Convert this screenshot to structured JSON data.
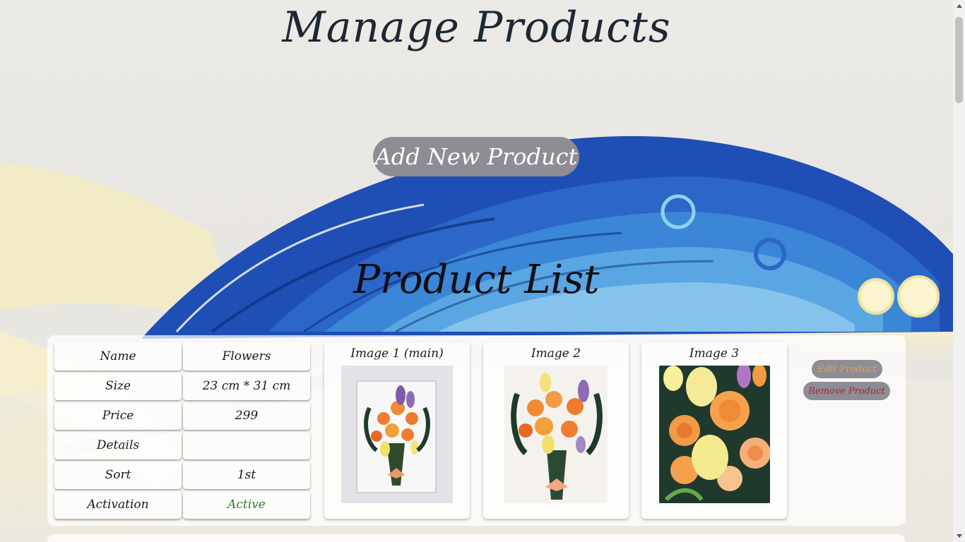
{
  "header": {
    "title": "Manage Products"
  },
  "actions": {
    "add_new_product": "Add New Product"
  },
  "list": {
    "title": "Product List"
  },
  "product": {
    "fields": [
      {
        "label": "Name",
        "value": "Flowers"
      },
      {
        "label": "Size",
        "value": "23 cm * 31 cm"
      },
      {
        "label": "Price",
        "value": "299"
      },
      {
        "label": "Details",
        "value": ""
      },
      {
        "label": "Sort",
        "value": "1st"
      },
      {
        "label": "Activation",
        "value": "Active"
      }
    ],
    "images": [
      {
        "label": "Image 1 (main)"
      },
      {
        "label": "Image 2"
      },
      {
        "label": "Image 3"
      }
    ],
    "buttons": {
      "edit": "Edit Product",
      "remove": "Remove Product"
    }
  },
  "colors": {
    "active_status": "#2f7a2a",
    "edit_text": "#e8a23a",
    "remove_text": "#b21f2c",
    "button_bg": "#8e8d96"
  }
}
